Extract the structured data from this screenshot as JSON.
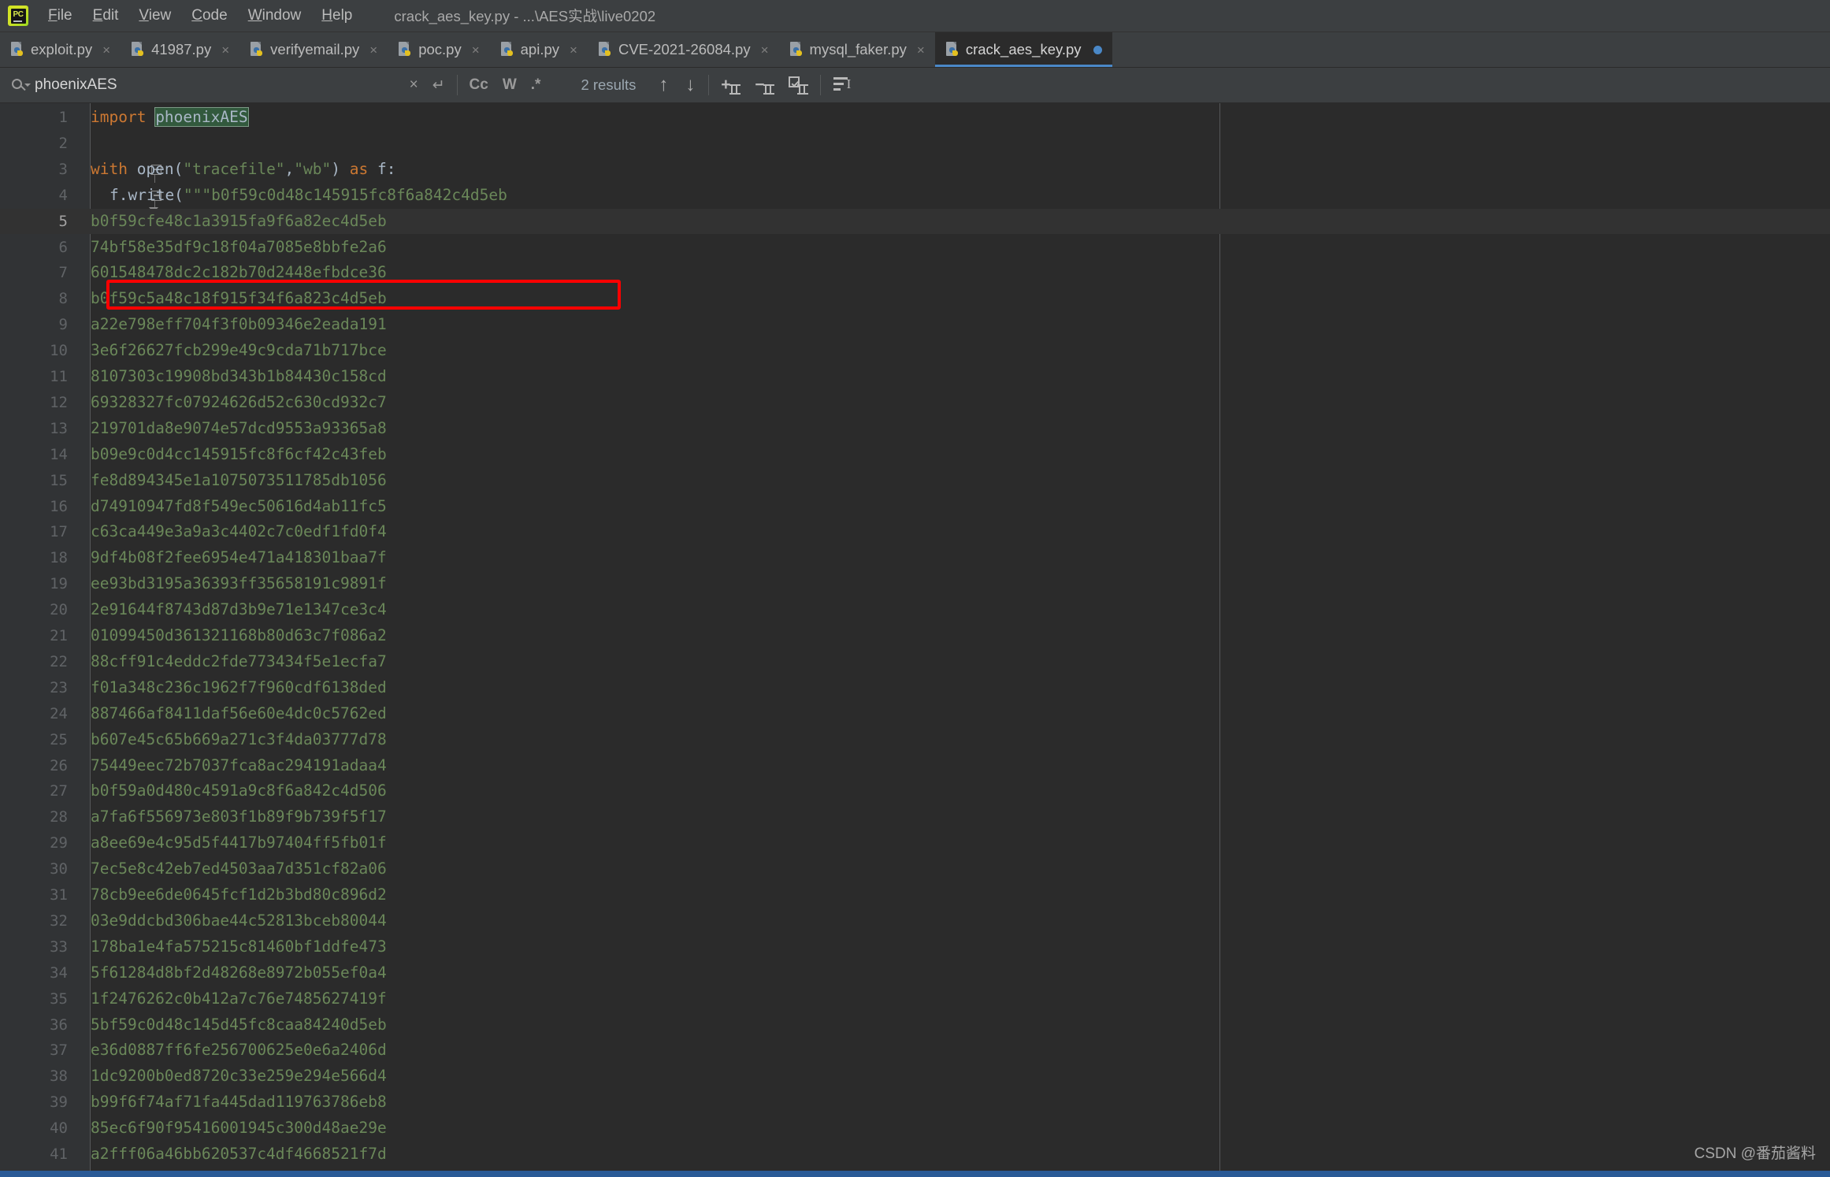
{
  "window": {
    "app_icon": "pycharm-logo",
    "title": "crack_aes_key.py - ...\\AES实战\\live0202",
    "menu": [
      {
        "label": "File",
        "mnemonic": "F"
      },
      {
        "label": "Edit",
        "mnemonic": "E"
      },
      {
        "label": "View",
        "mnemonic": "V"
      },
      {
        "label": "Code",
        "mnemonic": "C"
      },
      {
        "label": "Window",
        "mnemonic": "W"
      },
      {
        "label": "Help",
        "mnemonic": "H"
      }
    ]
  },
  "tabs": [
    {
      "label": "exploit.py",
      "active": false,
      "modified": false
    },
    {
      "label": "41987.py",
      "active": false,
      "modified": false
    },
    {
      "label": "verifyemail.py",
      "active": false,
      "modified": false
    },
    {
      "label": "poc.py",
      "active": false,
      "modified": false
    },
    {
      "label": "api.py",
      "active": false,
      "modified": false
    },
    {
      "label": "CVE-2021-26084.py",
      "active": false,
      "modified": false
    },
    {
      "label": "mysql_faker.py",
      "active": false,
      "modified": false
    },
    {
      "label": "crack_aes_key.py",
      "active": true,
      "modified": true
    }
  ],
  "find": {
    "query": "phoenixAES",
    "placeholder": "Search",
    "results_label": "2 results",
    "close_label": "×",
    "history_label": "↵",
    "match_case_label": "Cc",
    "words_label": "W",
    "regex_label": ".*",
    "prev_label": "↑",
    "next_label": "↓",
    "add_caret_label": "+",
    "remove_caret_label": "−",
    "select_all_carets_label": "☑",
    "filter_label": "filter-icon"
  },
  "editor": {
    "highlighted_line": 5,
    "lines": [
      {
        "n": 1,
        "type": "code",
        "segments": [
          {
            "t": "import ",
            "c": "kw"
          },
          {
            "t": "phoenixAES",
            "c": "match"
          }
        ]
      },
      {
        "n": 2,
        "type": "blank",
        "segments": []
      },
      {
        "n": 3,
        "type": "code",
        "fold": "start",
        "segments": [
          {
            "t": "with ",
            "c": "kw"
          },
          {
            "t": "open(",
            "c": "punct"
          },
          {
            "t": "\"tracefile\"",
            "c": "str"
          },
          {
            "t": ",",
            "c": "punct"
          },
          {
            "t": "\"wb\"",
            "c": "str"
          },
          {
            "t": ") ",
            "c": "punct"
          },
          {
            "t": "as ",
            "c": "kw"
          },
          {
            "t": "f:",
            "c": "punct"
          }
        ]
      },
      {
        "n": 4,
        "type": "code",
        "fold": "start2",
        "indent": 1,
        "segments": [
          {
            "t": "f.write(",
            "c": "punct"
          },
          {
            "t": "\"\"\"b0f59c0d48c145915fc8f6a842c4d5eb",
            "c": "str"
          }
        ]
      },
      {
        "n": 5,
        "type": "hex",
        "text": "b0f59cfe48c1a3915fa9f6a82ec4d5eb"
      },
      {
        "n": 6,
        "type": "hex",
        "text": "74bf58e35df9c18f04a7085e8bbfe2a6"
      },
      {
        "n": 7,
        "type": "hex",
        "text": "601548478dc2c182b70d2448efbdce36"
      },
      {
        "n": 8,
        "type": "hex",
        "text": "b0f59c5a48c18f915f34f6a823c4d5eb"
      },
      {
        "n": 9,
        "type": "hex",
        "text": "a22e798eff704f3f0b09346e2eada191"
      },
      {
        "n": 10,
        "type": "hex",
        "text": "3e6f26627fcb299e49c9cda71b717bce"
      },
      {
        "n": 11,
        "type": "hex",
        "text": "8107303c19908bd343b1b84430c158cd"
      },
      {
        "n": 12,
        "type": "hex",
        "text": "69328327fc07924626d52c630cd932c7"
      },
      {
        "n": 13,
        "type": "hex",
        "text": "219701da8e9074e57dcd9553a93365a8"
      },
      {
        "n": 14,
        "type": "hex",
        "text": "b09e9c0d4cc145915fc8f6cf42c43feb"
      },
      {
        "n": 15,
        "type": "hex",
        "text": "fe8d894345e1a1075073511785db1056"
      },
      {
        "n": 16,
        "type": "hex",
        "text": "d74910947fd8f549ec50616d4ab11fc5"
      },
      {
        "n": 17,
        "type": "hex",
        "text": "c63ca449e3a9a3c4402c7c0edf1fd0f4"
      },
      {
        "n": 18,
        "type": "hex",
        "text": "9df4b08f2fee6954e471a418301baa7f"
      },
      {
        "n": 19,
        "type": "hex",
        "text": "ee93bd3195a36393ff35658191c9891f"
      },
      {
        "n": 20,
        "type": "hex",
        "text": "2e91644f8743d87d3b9e71e1347ce3c4"
      },
      {
        "n": 21,
        "type": "hex",
        "text": "01099450d361321168b80d63c7f086a2"
      },
      {
        "n": 22,
        "type": "hex",
        "text": "88cff91c4eddc2fde773434f5e1ecfa7"
      },
      {
        "n": 23,
        "type": "hex",
        "text": "f01a348c236c1962f7f960cdf6138ded"
      },
      {
        "n": 24,
        "type": "hex",
        "text": "887466af8411daf56e60e4dc0c5762ed"
      },
      {
        "n": 25,
        "type": "hex",
        "text": "b607e45c65b669a271c3f4da03777d78"
      },
      {
        "n": 26,
        "type": "hex",
        "text": "75449eec72b7037fca8ac294191adaa4"
      },
      {
        "n": 27,
        "type": "hex",
        "text": "b0f59a0d480c4591a9c8f6a842c4d506"
      },
      {
        "n": 28,
        "type": "hex",
        "text": "a7fa6f556973e803f1b89f9b739f5f17"
      },
      {
        "n": 29,
        "type": "hex",
        "text": "a8ee69e4c95d5f4417b97404ff5fb01f"
      },
      {
        "n": 30,
        "type": "hex",
        "text": "7ec5e8c42eb7ed4503aa7d351cf82a06"
      },
      {
        "n": 31,
        "type": "hex",
        "text": "78cb9ee6de0645fcf1d2b3bd80c896d2"
      },
      {
        "n": 32,
        "type": "hex",
        "text": "03e9ddcbd306bae44c52813bceb80044"
      },
      {
        "n": 33,
        "type": "hex",
        "text": "178ba1e4fa575215c81460bf1ddfe473"
      },
      {
        "n": 34,
        "type": "hex",
        "text": "5f61284d8bf2d48268e8972b055ef0a4"
      },
      {
        "n": 35,
        "type": "hex",
        "text": "1f2476262c0b412a7c76e7485627419f"
      },
      {
        "n": 36,
        "type": "hex",
        "text": "5bf59c0d48c145d45fc8caa84240d5eb"
      },
      {
        "n": 37,
        "type": "hex",
        "text": "e36d0887ff6fe256700625e0e6a2406d"
      },
      {
        "n": 38,
        "type": "hex",
        "text": "1dc9200b0ed8720c33e259e294e566d4"
      },
      {
        "n": 39,
        "type": "hex",
        "text": "b99f6f74af71fa445dad119763786eb8"
      },
      {
        "n": 40,
        "type": "hex",
        "text": "85ec6f90f95416001945c300d48ae29e"
      },
      {
        "n": 41,
        "type": "hex",
        "text": "a2fff06a46bb620537c4df4668521f7d"
      }
    ]
  },
  "annotation": {
    "color": "#ff0000",
    "target_line": 4
  },
  "watermark": {
    "text": "CSDN @番茄酱料"
  },
  "colors": {
    "chrome": "#3c3f41",
    "editor_bg": "#2b2b2b",
    "gutter_bg": "#313335",
    "accent": "#4a88c7",
    "keyword": "#cc7832",
    "string": "#6a8759",
    "text": "#a9b7c6",
    "match_bg": "#32593d",
    "status": "#2a5a96"
  }
}
